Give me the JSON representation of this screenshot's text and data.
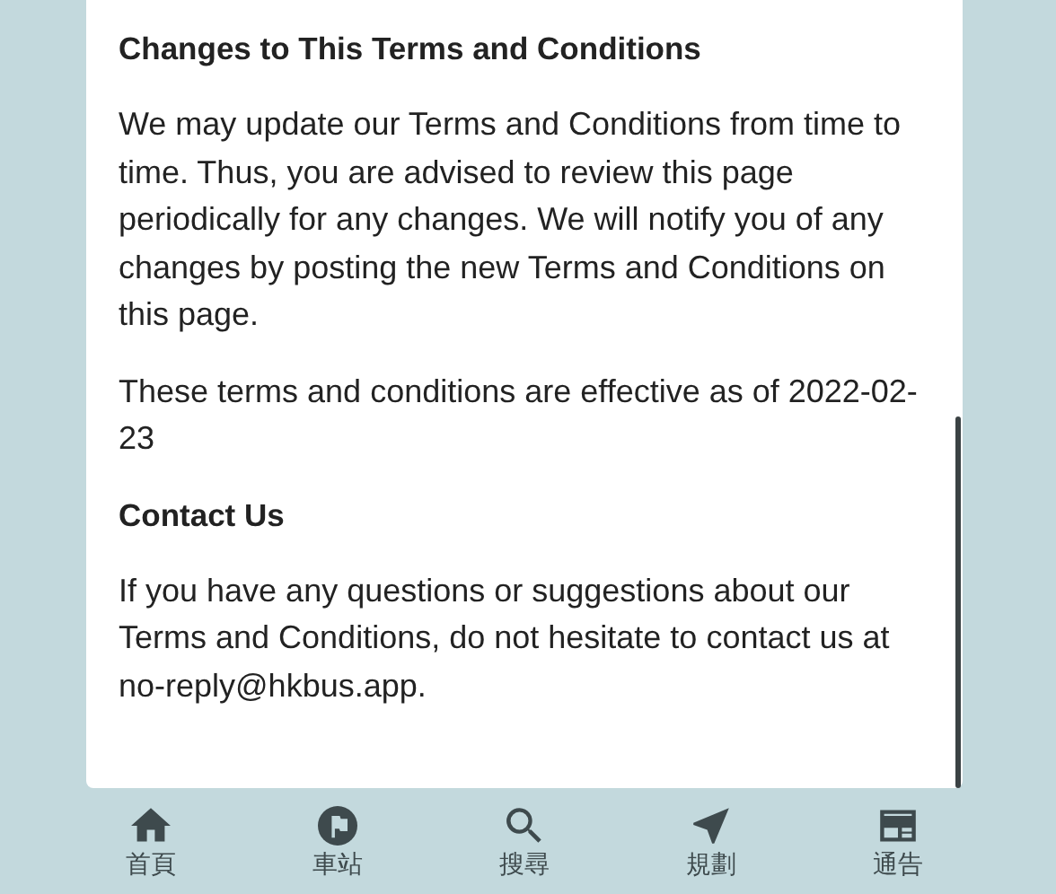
{
  "content": {
    "sections": [
      {
        "kind": "heading",
        "text": "Changes to This Terms and Conditions"
      },
      {
        "kind": "paragraph",
        "text": "We may update our Terms and Conditions from time to time. Thus, you are advised to review this page periodically for any changes. We will notify you of any changes by posting the new Terms and Conditions on this page."
      },
      {
        "kind": "paragraph",
        "text": "These terms and conditions are effective as of 2022-02-23"
      },
      {
        "kind": "heading",
        "text": "Contact Us"
      },
      {
        "kind": "paragraph",
        "text": "If you have any questions or suggestions about our Terms and Conditions, do not hesitate to contact us at no-reply@hkbus.app."
      }
    ]
  },
  "bottom_nav": [
    {
      "label": "首頁",
      "selected": false
    },
    {
      "label": "車站",
      "selected": false
    },
    {
      "label": "搜尋",
      "selected": false
    },
    {
      "label": "規劃",
      "selected": false
    },
    {
      "label": "通告",
      "selected": false
    }
  ]
}
